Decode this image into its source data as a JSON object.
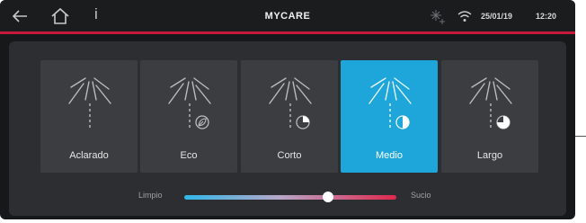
{
  "header": {
    "title": "MYCARE",
    "date": "25/01/19",
    "time": "12:20",
    "info_label": "i",
    "icons": [
      "back-arrow-icon",
      "home-icon",
      "info-icon",
      "sparkle-icon",
      "wifi-icon"
    ]
  },
  "programs": [
    {
      "label": "Aclarado",
      "indicator": "none",
      "fill": 0,
      "active": false
    },
    {
      "label": "Eco",
      "indicator": "leaf",
      "fill": 0,
      "active": false
    },
    {
      "label": "Corto",
      "indicator": "pie",
      "fill": 0.25,
      "active": false
    },
    {
      "label": "Medio",
      "indicator": "pie",
      "fill": 0.5,
      "active": true
    },
    {
      "label": "Largo",
      "indicator": "pie",
      "fill": 0.75,
      "active": false
    }
  ],
  "soil_slider": {
    "min_label": "Limpio",
    "max_label": "Sucio",
    "value": 0.68
  },
  "colors": {
    "accent_red": "#c6193b",
    "active_blue": "#1ea5d9",
    "slider_start": "#2fb8e8",
    "slider_end": "#e0284d"
  }
}
